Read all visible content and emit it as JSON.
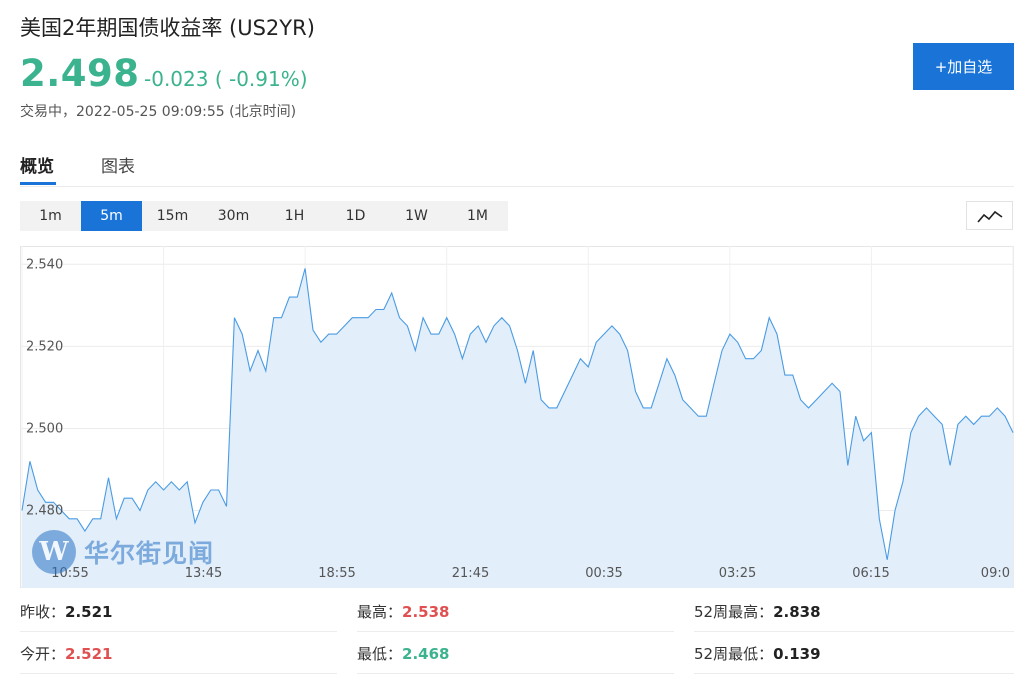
{
  "header": {
    "title": "美国2年期国债收益率 (US2YR)",
    "price": "2.498",
    "change": "-0.023 ( -0.91%)",
    "status": "交易中，2022-05-25 09:09:55 (北京时间)",
    "add_button": "+加自选"
  },
  "tabs": [
    {
      "label": "概览",
      "active": true
    },
    {
      "label": "图表",
      "active": false
    }
  ],
  "periods": [
    {
      "label": "1m",
      "active": false
    },
    {
      "label": "5m",
      "active": true
    },
    {
      "label": "15m",
      "active": false
    },
    {
      "label": "30m",
      "active": false
    },
    {
      "label": "1H",
      "active": false
    },
    {
      "label": "1D",
      "active": false
    },
    {
      "label": "1W",
      "active": false
    },
    {
      "label": "1M",
      "active": false
    }
  ],
  "chart_type_icon": "line-chart-icon",
  "watermark": {
    "logo_letter": "W",
    "text": "华尔街见闻"
  },
  "colors": {
    "up": "#e05050",
    "down": "#3bb38e",
    "accent": "#1a74d8",
    "line": "#4a9be3",
    "area": "#e2effb"
  },
  "chart_data": {
    "type": "area",
    "ylim": [
      2.466,
      2.543
    ],
    "y_ticks": [
      "2.540",
      "2.520",
      "2.500",
      "2.480"
    ],
    "x_ticks": [
      "10:55",
      "13:45",
      "18:55",
      "21:45",
      "00:35",
      "03:25",
      "06:15",
      "09:0"
    ],
    "values": [
      2.48,
      2.492,
      2.485,
      2.482,
      2.482,
      2.48,
      2.478,
      2.478,
      2.475,
      2.478,
      2.478,
      2.488,
      2.478,
      2.483,
      2.483,
      2.48,
      2.485,
      2.487,
      2.485,
      2.487,
      2.485,
      2.487,
      2.477,
      2.482,
      2.485,
      2.485,
      2.481,
      2.527,
      2.523,
      2.514,
      2.519,
      2.514,
      2.527,
      2.527,
      2.532,
      2.532,
      2.539,
      2.524,
      2.521,
      2.523,
      2.523,
      2.525,
      2.527,
      2.527,
      2.527,
      2.529,
      2.529,
      2.533,
      2.527,
      2.525,
      2.519,
      2.527,
      2.523,
      2.523,
      2.527,
      2.523,
      2.517,
      2.523,
      2.525,
      2.521,
      2.525,
      2.527,
      2.525,
      2.519,
      2.511,
      2.519,
      2.507,
      2.505,
      2.505,
      2.509,
      2.513,
      2.517,
      2.515,
      2.521,
      2.523,
      2.525,
      2.523,
      2.519,
      2.509,
      2.505,
      2.505,
      2.511,
      2.517,
      2.513,
      2.507,
      2.505,
      2.503,
      2.503,
      2.511,
      2.519,
      2.523,
      2.521,
      2.517,
      2.517,
      2.519,
      2.527,
      2.523,
      2.513,
      2.513,
      2.507,
      2.505,
      2.507,
      2.509,
      2.511,
      2.509,
      2.491,
      2.503,
      2.497,
      2.499,
      2.478,
      2.468,
      2.48,
      2.487,
      2.499,
      2.503,
      2.505,
      2.503,
      2.501,
      2.491,
      2.501,
      2.503,
      2.501,
      2.503,
      2.503,
      2.505,
      2.503,
      2.499
    ]
  },
  "stats": [
    {
      "label": "昨收：",
      "value": "2.521",
      "tone": "neutral"
    },
    {
      "label": "最高：",
      "value": "2.538",
      "tone": "up"
    },
    {
      "label": "52周最高：",
      "value": "2.838",
      "tone": "neutral"
    },
    {
      "label": "今开：",
      "value": "2.521",
      "tone": "up"
    },
    {
      "label": "最低：",
      "value": "2.468",
      "tone": "down"
    },
    {
      "label": "52周最低：",
      "value": "0.139",
      "tone": "neutral"
    }
  ]
}
